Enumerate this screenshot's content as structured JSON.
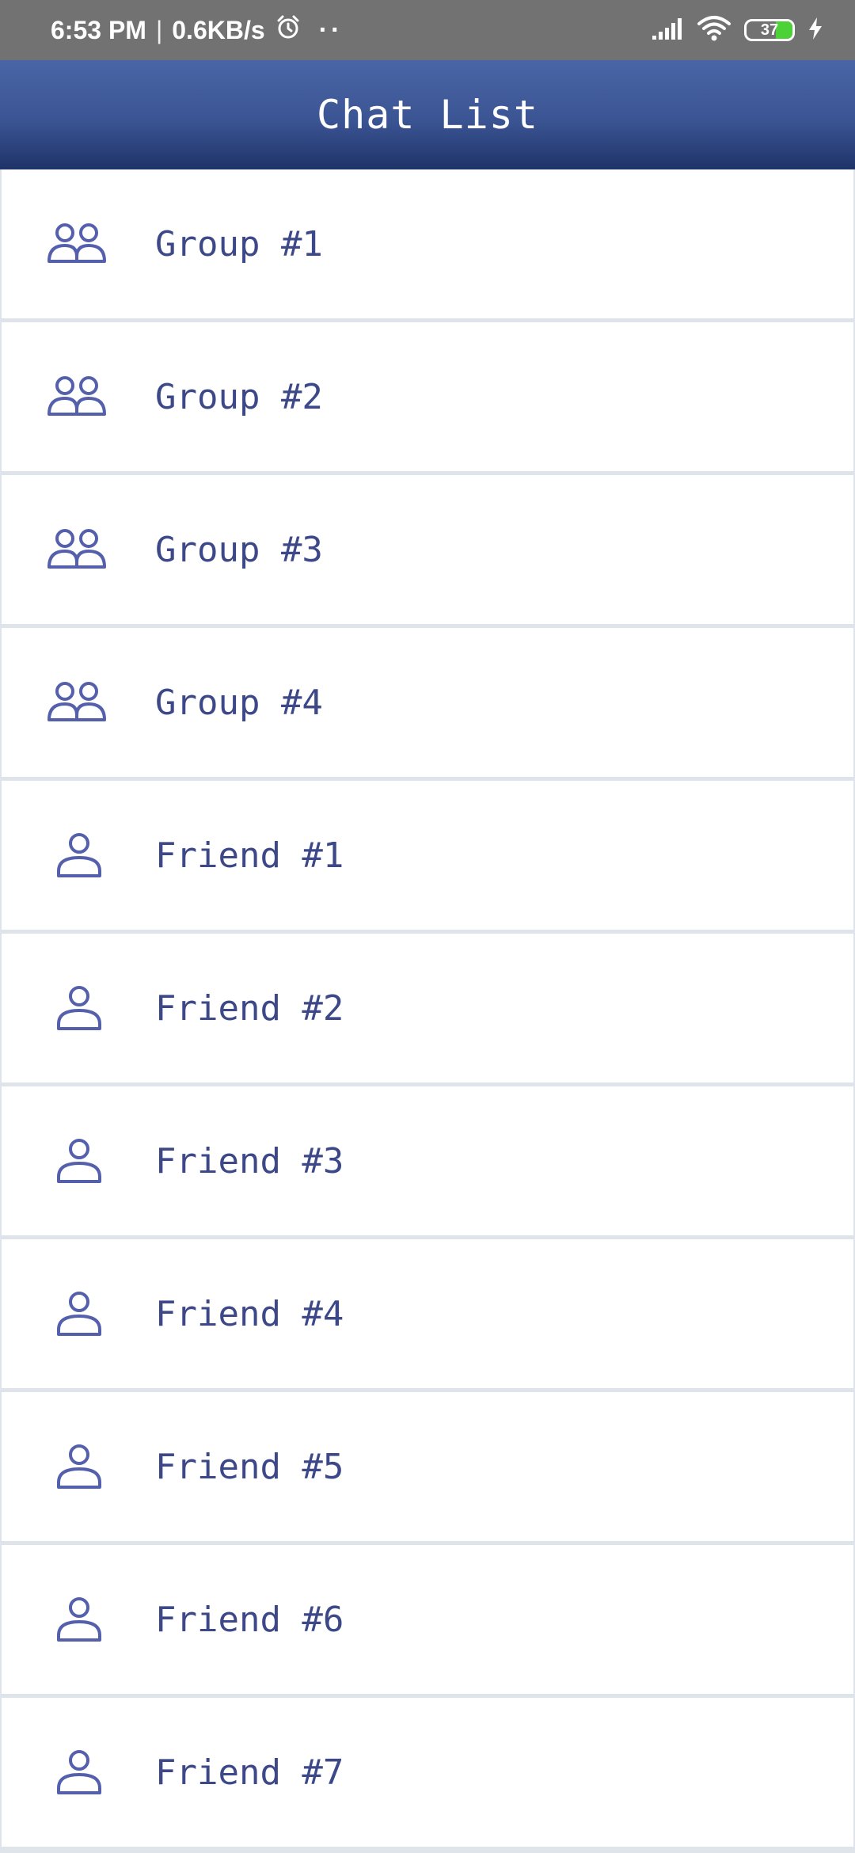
{
  "status_bar": {
    "time": "6:53 PM",
    "separator": "|",
    "speed": "0.6KB/s",
    "dots": "··",
    "battery_level": "37",
    "battery_fraction": 0.37
  },
  "app_bar": {
    "title": "Chat List"
  },
  "colors": {
    "accent": "#3c4887",
    "icon": "#5560ad",
    "app_bar_top": "#4a65a5",
    "app_bar_bottom": "#1e3368",
    "status_bar": "#727272",
    "divider": "#dfe4ea"
  },
  "chats": [
    {
      "label": "Group #1",
      "icon": "group-icon"
    },
    {
      "label": "Group #2",
      "icon": "group-icon"
    },
    {
      "label": "Group #3",
      "icon": "group-icon"
    },
    {
      "label": "Group #4",
      "icon": "group-icon"
    },
    {
      "label": "Friend #1",
      "icon": "person-icon"
    },
    {
      "label": "Friend #2",
      "icon": "person-icon"
    },
    {
      "label": "Friend #3",
      "icon": "person-icon"
    },
    {
      "label": "Friend #4",
      "icon": "person-icon"
    },
    {
      "label": "Friend #5",
      "icon": "person-icon"
    },
    {
      "label": "Friend #6",
      "icon": "person-icon"
    },
    {
      "label": "Friend #7",
      "icon": "person-icon"
    }
  ]
}
